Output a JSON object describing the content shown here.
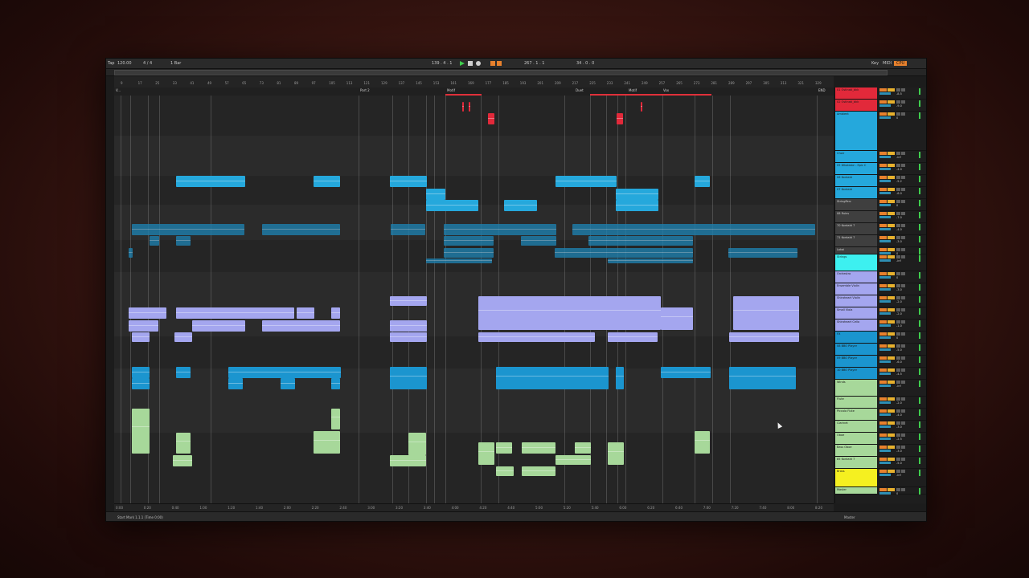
{
  "transport": {
    "tap": "Tap",
    "tempo": "120.00",
    "signature": "4 / 4",
    "quantize": "1 Bar",
    "position": "139 . 4 . 1",
    "loop_start": "267 . 1 . 1",
    "loop_length": "34 . 0 . 0",
    "key_label": "Key",
    "midi_label": "MIDI",
    "cpu_label": "CPU"
  },
  "ruler": {
    "bars": [
      "9",
      "17",
      "25",
      "33",
      "41",
      "49",
      "57",
      "65",
      "73",
      "81",
      "89",
      "97",
      "105",
      "113",
      "121",
      "129",
      "137",
      "145",
      "153",
      "161",
      "169",
      "177",
      "185",
      "193",
      "201",
      "209",
      "217",
      "225",
      "233",
      "241",
      "249",
      "257",
      "265",
      "273",
      "281",
      "289",
      "297",
      "305",
      "313",
      "321",
      "329"
    ]
  },
  "locators": [
    {
      "label": "V...",
      "color": "#d0d0d0"
    },
    {
      "label": "Part 2",
      "color": "#d0d0d0"
    },
    {
      "label": "Motif",
      "color": "#d0d0d0"
    },
    {
      "label": "Duet",
      "color": "#d0d0d0"
    },
    {
      "label": "Motif",
      "color": "#d0d0d0"
    },
    {
      "label": "Vox",
      "color": "#d0d0d0"
    },
    {
      "label": "END",
      "color": "#d0d0d0"
    }
  ],
  "time_marks": [
    "0:00",
    "0:20",
    "0:40",
    "1:00",
    "1:20",
    "1:40",
    "2:00",
    "2:20",
    "2:40",
    "3:00",
    "3:20",
    "3:40",
    "4:00",
    "4:20",
    "4:40",
    "5:00",
    "5:20",
    "5:40",
    "6:00",
    "6:20",
    "6:40",
    "7:00",
    "7:20",
    "7:40",
    "8:00",
    "8:20"
  ],
  "status": {
    "left": "Start Mark 1.1.1 (Time 0:00)",
    "right": "Master"
  },
  "tracks": [
    {
      "name": "01 Ostinati_bkk",
      "color": "#e2293a",
      "vol": "-8.5",
      "height": 14
    },
    {
      "name": "02 Ostinati_bkk",
      "color": "#e2293a",
      "vol": "-9.0",
      "height": 14
    },
    {
      "name": "Ambient",
      "color": "#25a8dc",
      "vol": "0",
      "height": 48
    },
    {
      "name": "Choir",
      "color": "#25a8dc",
      "vol": "-inf",
      "height": 14
    },
    {
      "name": "05 Whalesbr - Epic C",
      "color": "#25a8dc",
      "vol": "-4.0",
      "height": 14
    },
    {
      "name": "06 Kontakt",
      "color": "#25a8dc",
      "vol": "-5.2",
      "height": 14
    },
    {
      "name": "07 Kontakt",
      "color": "#25a8dc",
      "vol": "-6.0",
      "height": 14
    },
    {
      "name": "StringPerc",
      "color": "#3f3f3f",
      "vol": "0",
      "height": 14
    },
    {
      "name": "08 Ruins",
      "color": "#3f3f3f",
      "vol": "-7.0",
      "height": 14
    },
    {
      "name": "70 Kontakt 7",
      "color": "#3f3f3f",
      "vol": "-4.0",
      "height": 14
    },
    {
      "name": "71 Kontakt 7",
      "color": "#3f3f3f",
      "vol": "-3.0",
      "height": 14
    },
    {
      "name": "Lokai",
      "color": "#3f3f3f",
      "vol": "0",
      "height": 8
    },
    {
      "name": "Strings",
      "color": "#3df0f0",
      "vol": "-inf",
      "height": 20
    },
    {
      "name": "Orchestra",
      "color": "#a4a6ef",
      "vol": "0",
      "height": 14
    },
    {
      "name": "Ensemble Violin",
      "color": "#a4a6ef",
      "vol": "-3.0",
      "height": 14
    },
    {
      "name": "Shiraheart Violin",
      "color": "#a4a6ef",
      "vol": "-2.0",
      "height": 14
    },
    {
      "name": "Small Viola",
      "color": "#a4a6ef",
      "vol": "-2.0",
      "height": 14
    },
    {
      "name": "Shiraheart Cello",
      "color": "#a4a6ef",
      "vol": "-1.0",
      "height": 14
    },
    {
      "name": "FX",
      "color": "#1b95cf",
      "vol": "0",
      "height": 14
    },
    {
      "name": "08 BBO Player",
      "color": "#1b95cf",
      "vol": "-5.0",
      "height": 14
    },
    {
      "name": "09 BBO Player",
      "color": "#1b95cf",
      "vol": "-6.0",
      "height": 14
    },
    {
      "name": "10 BBO Player",
      "color": "#1b95cf",
      "vol": "-4.5",
      "height": 14
    },
    {
      "name": "Winds",
      "color": "#a7d89a",
      "vol": "-inf",
      "height": 20
    },
    {
      "name": "Flute",
      "color": "#a7d89a",
      "vol": "-2.0",
      "height": 14
    },
    {
      "name": "Piccolo Flute",
      "color": "#a7d89a",
      "vol": "-4.0",
      "height": 14
    },
    {
      "name": "Clarinet",
      "color": "#a7d89a",
      "vol": "-3.0",
      "height": 14
    },
    {
      "name": "Oboe",
      "color": "#a7d89a",
      "vol": "-2.5",
      "height": 14
    },
    {
      "name": "Bass Oboe",
      "color": "#a7d89a",
      "vol": "-3.0",
      "height": 14
    },
    {
      "name": "85 Kontakt 7",
      "color": "#a7d89a",
      "vol": "-5.0",
      "height": 14
    },
    {
      "name": "Brass",
      "color": "#f5f020",
      "vol": "-inf",
      "height": 22
    },
    {
      "name": "Master",
      "color": "#a7d89a",
      "vol": "0",
      "height": 8
    }
  ]
}
